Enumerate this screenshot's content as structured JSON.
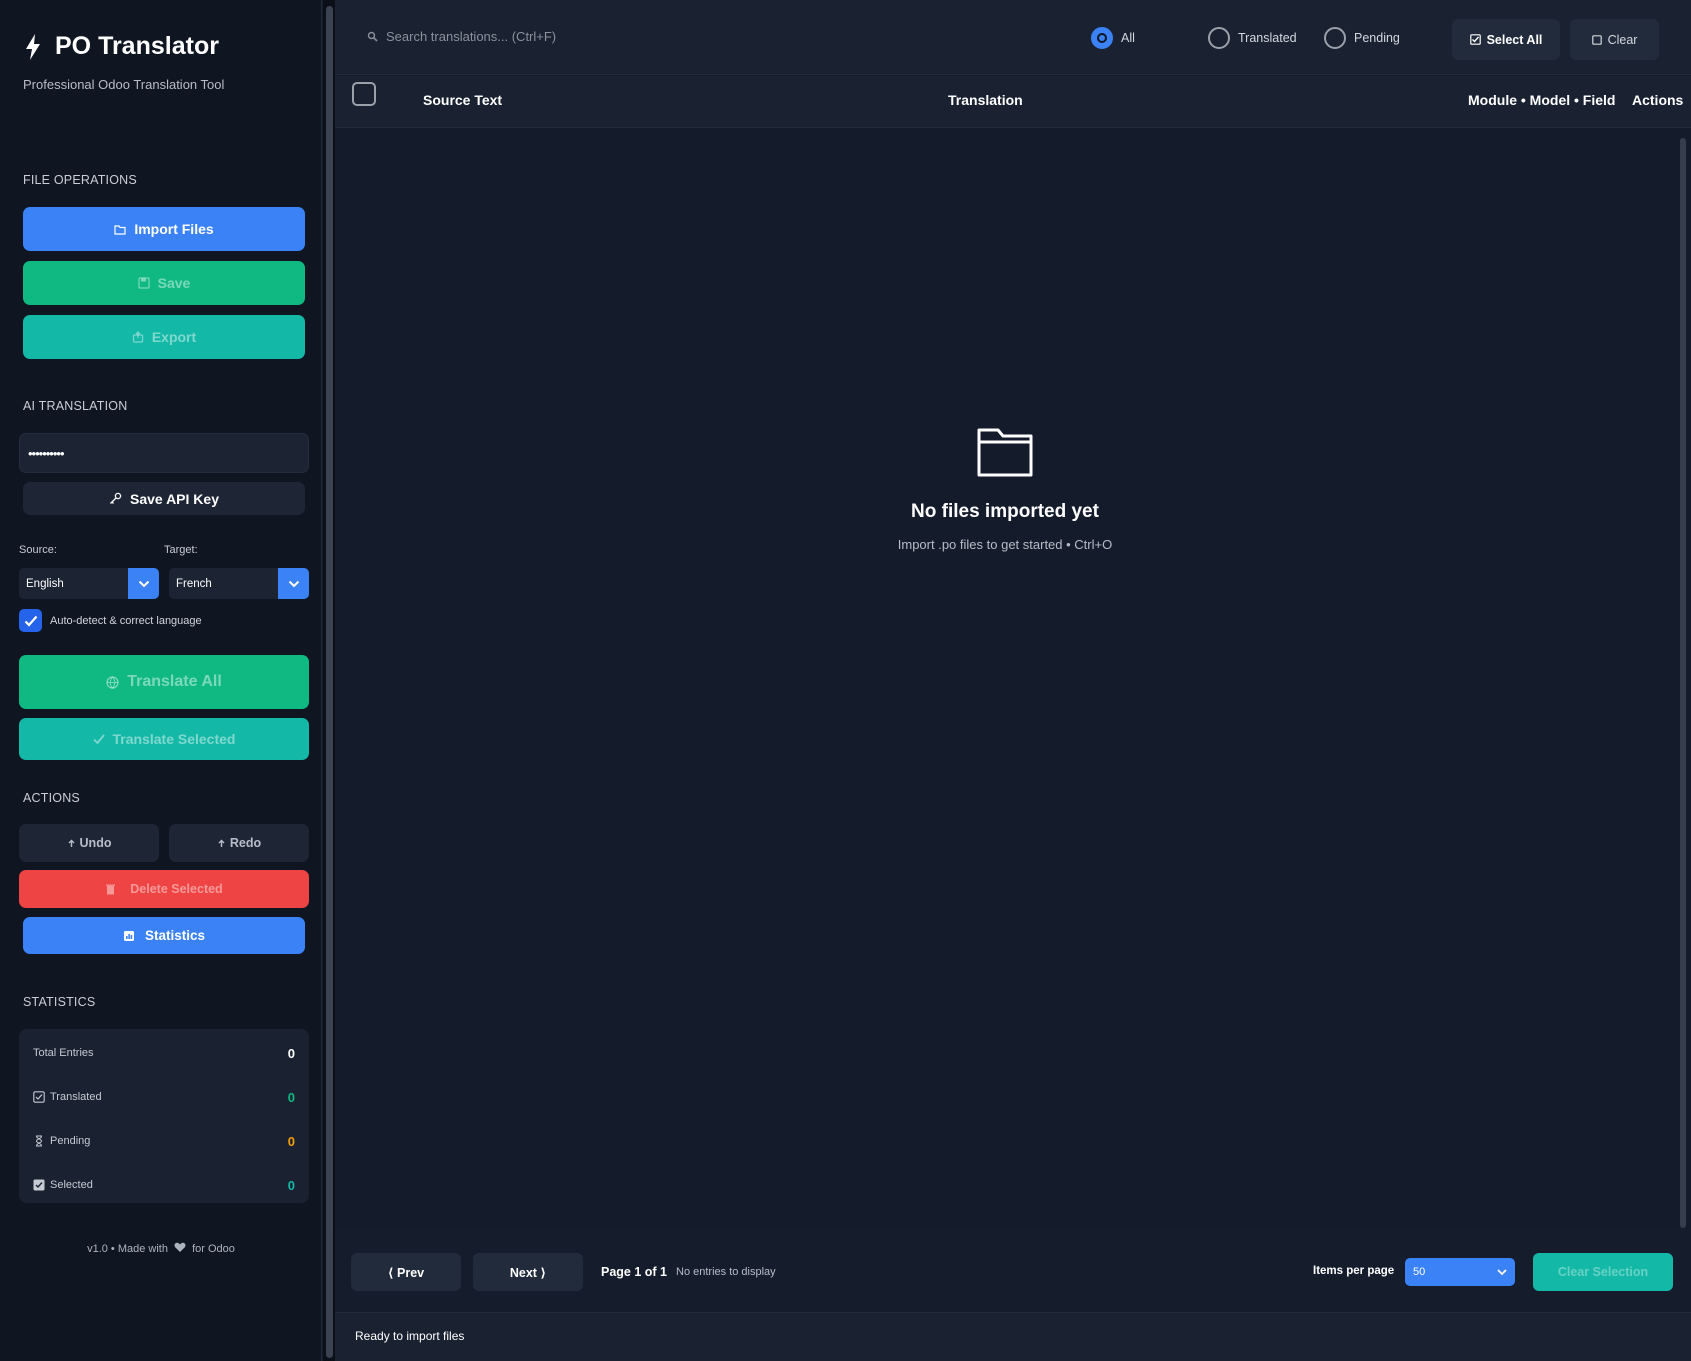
{
  "app": {
    "title": "PO Translator",
    "subtitle": "Professional Odoo Translation Tool"
  },
  "sidebar": {
    "file_operations": {
      "title": "FILE OPERATIONS",
      "import_label": "Import Files",
      "save_label": "Save",
      "export_label": "Export"
    },
    "ai_translation": {
      "title": "AI TRANSLATION",
      "api_key_value": "••••••••••",
      "save_api_key_label": "Save API Key",
      "source_label": "Source:",
      "target_label": "Target:",
      "source_value": "English",
      "target_value": "French",
      "auto_detect_label": "Auto-detect & correct language",
      "auto_detect_checked": true,
      "translate_all_label": "Translate All",
      "translate_selected_label": "Translate Selected"
    },
    "actions": {
      "title": "ACTIONS",
      "undo_label": "Undo",
      "redo_label": "Redo",
      "delete_selected_label": "Delete Selected",
      "statistics_label": "Statistics"
    },
    "statistics": {
      "title": "STATISTICS",
      "rows": [
        {
          "label": "Total Entries",
          "value": "0",
          "color": "#ffffff",
          "icon": "none"
        },
        {
          "label": "Translated",
          "value": "0",
          "color": "#10b981",
          "icon": "check-box-icon"
        },
        {
          "label": "Pending",
          "value": "0",
          "color": "#f59e0b",
          "icon": "hourglass-icon"
        },
        {
          "label": "Selected",
          "value": "0",
          "color": "#14b8a6",
          "icon": "checked-box-icon"
        }
      ]
    },
    "footer": {
      "prefix": "v1.0 • Made with",
      "suffix": "for Odoo"
    }
  },
  "toolbar": {
    "search_placeholder": "Search translations... (Ctrl+F)",
    "filters": [
      {
        "label": "All",
        "selected": true
      },
      {
        "label": "Translated",
        "selected": false
      },
      {
        "label": "Pending",
        "selected": false
      }
    ],
    "select_all_label": "Select All",
    "clear_label": "Clear"
  },
  "table": {
    "columns": [
      "Source Text",
      "Translation",
      "Module • Model • Field",
      "Actions"
    ]
  },
  "empty_state": {
    "title": "No files imported yet",
    "subtitle": "Import .po files to get started • Ctrl+O"
  },
  "pager": {
    "prev_label": "⟨ Prev",
    "next_label": "Next ⟩",
    "page_info": "Page 1 of 1",
    "entries_info": "No entries to display",
    "items_per_page_label": "Items per page",
    "items_per_page_value": "50",
    "clear_selection_label": "Clear Selection"
  },
  "status": {
    "text": "Ready to import files"
  },
  "colors": {
    "accent_blue": "#3b82f6",
    "green": "#10b981",
    "teal": "#14b8a6",
    "red": "#ef4444",
    "amber": "#f59e0b"
  }
}
